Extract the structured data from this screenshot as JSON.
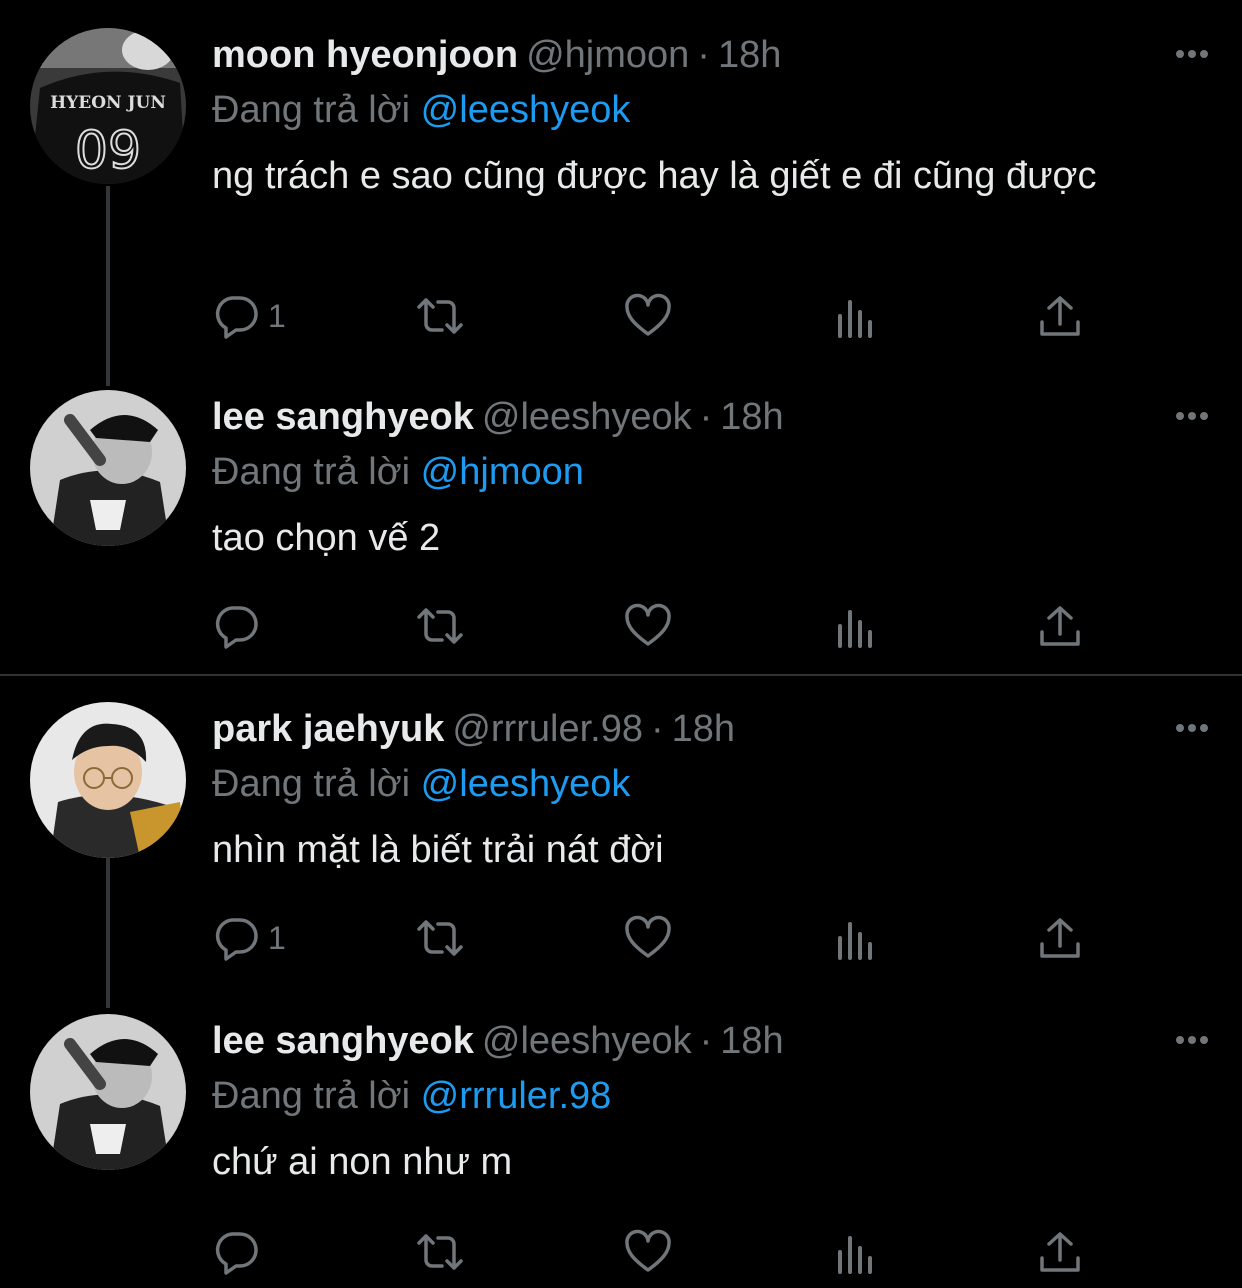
{
  "reply_prefix": "Đang trả lời",
  "colors": {
    "background": "#000000",
    "text": "#e7e9ea",
    "muted": "#71767b",
    "mention": "#1d9bf0",
    "divider": "#2f3336"
  },
  "tweets": [
    {
      "name": "moon hyeonjoon",
      "handle": "@hjmoon",
      "time": "18h",
      "reply_to": "@leeshyeok",
      "text": "ng trách e sao cũng được hay là giết e đi cũng được",
      "reply_count": "1",
      "avatar_icon": "avatar-jersey",
      "avatar_jersey_name": "HYEON JUN",
      "avatar_jersey_number": "09"
    },
    {
      "name": "lee sanghyeok",
      "handle": "@leeshyeok",
      "time": "18h",
      "reply_to": "@hjmoon",
      "text": "tao chọn vế 2",
      "reply_count": "",
      "avatar_icon": "avatar-cap-bw"
    },
    {
      "name": "park jaehyuk",
      "handle": "@rrruler.98",
      "time": "18h",
      "reply_to": "@leeshyeok",
      "text": "nhìn mặt là biết trải nát đời",
      "reply_count": "1",
      "avatar_icon": "avatar-glasses"
    },
    {
      "name": "lee sanghyeok",
      "handle": "@leeshyeok",
      "time": "18h",
      "reply_to": "@rrruler.98",
      "text": "chứ ai non như m",
      "reply_count": "",
      "avatar_icon": "avatar-cap-bw"
    }
  ]
}
